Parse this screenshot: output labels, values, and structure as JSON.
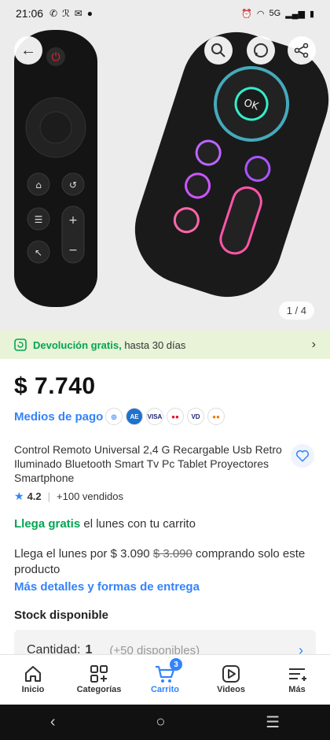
{
  "status": {
    "time": "21:06",
    "network": "5G"
  },
  "gallery": {
    "counter": "1 / 4"
  },
  "returns": {
    "highlight": "Devolución gratis,",
    "rest": " hasta 30 días"
  },
  "product": {
    "price": "$ 7.740",
    "payment_link": "Medios de pago",
    "payment_icons": [
      "mercadopago-icon",
      "amex-icon",
      "visa-icon",
      "mastercard-icon",
      "visa-debit-icon",
      "maestro-icon"
    ],
    "title": "Control Remoto Universal 2,4 G Recargable Usb Retro Iluminado Bluetooth Smart Tv Pc Tablet Proyectores Smartphone",
    "rating": "4.2",
    "sold": "+100 vendidos"
  },
  "shipping": {
    "free_label": "Llega gratis",
    "free_rest": " el lunes con tu carrito",
    "paid_prefix": "Llega el lunes por ",
    "paid_price": "$ 3.090",
    "paid_old_price": "$ 3.090",
    "paid_suffix": " comprando solo este producto",
    "details_link": "Más detalles y formas de entrega"
  },
  "stock": {
    "title": "Stock disponible",
    "qty_label": "Cantidad:",
    "qty_value": "1",
    "available": "(+50 disponibles)"
  },
  "nav": {
    "items": [
      {
        "label": "Inicio",
        "icon": "home-icon"
      },
      {
        "label": "Categorías",
        "icon": "categories-icon"
      },
      {
        "label": "Carrito",
        "icon": "cart-icon",
        "badge": "3"
      },
      {
        "label": "Videos",
        "icon": "play-icon"
      },
      {
        "label": "Más",
        "icon": "menu-icon"
      }
    ]
  },
  "colors": {
    "accent": "#3483fa",
    "green": "#00a650",
    "returns_bg": "#e8f3d8"
  }
}
